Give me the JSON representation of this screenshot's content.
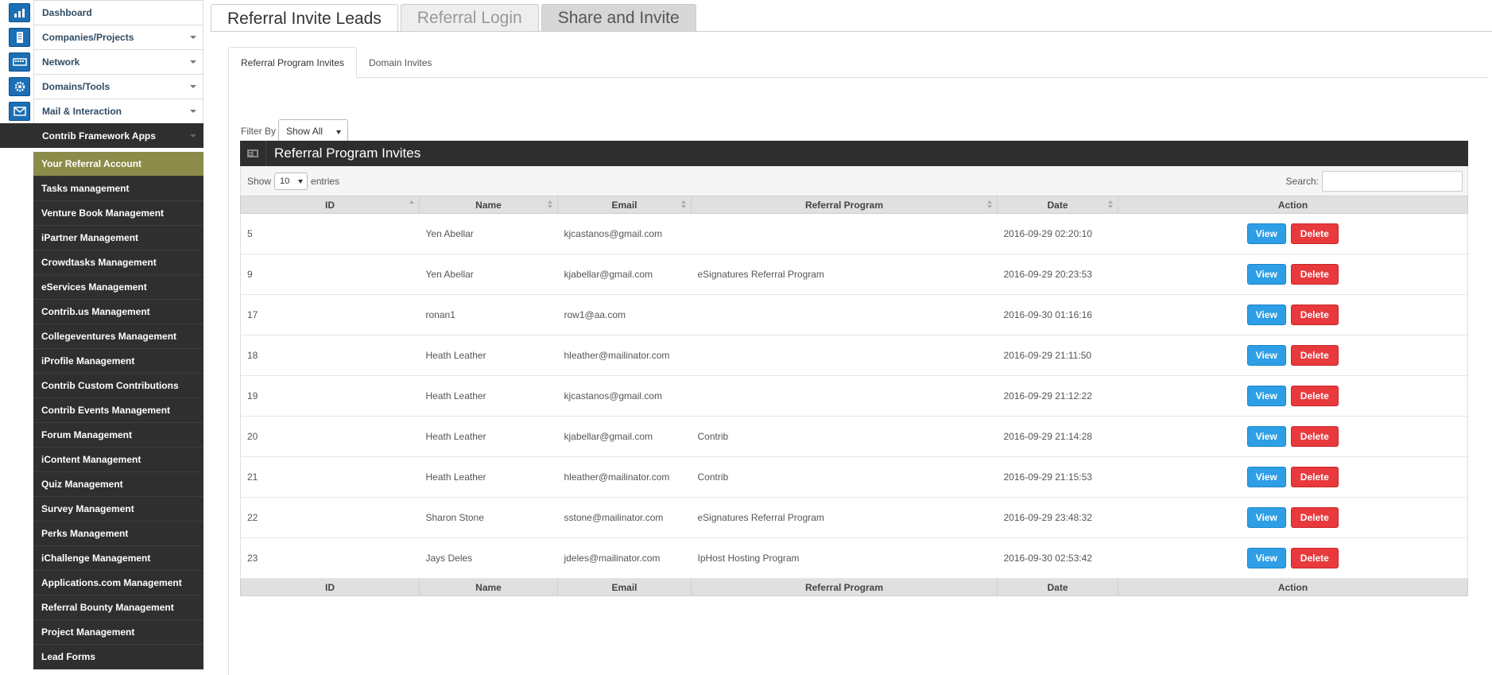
{
  "sidebar": {
    "main_items": [
      {
        "label": "Dashboard",
        "icon": "chart-icon",
        "has_caret": false
      },
      {
        "label": "Companies/Projects",
        "icon": "building-icon",
        "has_caret": true
      },
      {
        "label": "Network",
        "icon": "network-icon",
        "has_caret": true
      },
      {
        "label": "Domains/Tools",
        "icon": "gear-icon",
        "has_caret": true
      },
      {
        "label": "Mail & Interaction",
        "icon": "mail-icon",
        "has_caret": true
      },
      {
        "label": "Contrib Framework Apps",
        "icon": "puzzle-icon",
        "has_caret": true
      }
    ],
    "sub_items": [
      "Your Referral Account",
      "Tasks management",
      "Venture Book Management",
      "iPartner Management",
      "Crowdtasks Management",
      "eServices Management",
      "Contrib.us Management",
      "Collegeventures Management",
      "iProfile Management",
      "Contrib Custom Contributions",
      "Contrib Events Management",
      "Forum Management",
      "iContent Management",
      "Quiz Management",
      "Survey Management",
      "Perks Management",
      "iChallenge Management",
      "Applications.com Management",
      "Referral Bounty Management",
      "Project Management",
      "Lead Forms"
    ],
    "active_sub": "Your Referral Account"
  },
  "top_tabs": [
    "Referral Invite Leads",
    "Referral Login",
    "Share and Invite"
  ],
  "sub_tabs": [
    "Referral Program Invites",
    "Domain Invites"
  ],
  "filter": {
    "label": "Filter By",
    "value": "Show All"
  },
  "box": {
    "title": "Referral Program Invites"
  },
  "length": {
    "show": "Show",
    "value": "10",
    "entries": "entries"
  },
  "search": {
    "label": "Search:"
  },
  "table": {
    "columns": [
      "ID",
      "Name",
      "Email",
      "Referral Program",
      "Date",
      "Action"
    ],
    "rows": [
      {
        "id": "5",
        "name": "Yen Abellar",
        "email": "kjcastanos@gmail.com",
        "program": "",
        "date": "2016-09-29 02:20:10"
      },
      {
        "id": "9",
        "name": "Yen Abellar",
        "email": "kjabellar@gmail.com",
        "program": "eSignatures Referral Program",
        "date": "2016-09-29 20:23:53"
      },
      {
        "id": "17",
        "name": "ronan1",
        "email": "row1@aa.com",
        "program": "",
        "date": "2016-09-30 01:16:16"
      },
      {
        "id": "18",
        "name": "Heath Leather",
        "email": "hleather@mailinator.com",
        "program": "",
        "date": "2016-09-29 21:11:50"
      },
      {
        "id": "19",
        "name": "Heath Leather",
        "email": "kjcastanos@gmail.com",
        "program": "",
        "date": "2016-09-29 21:12:22"
      },
      {
        "id": "20",
        "name": "Heath Leather",
        "email": "kjabellar@gmail.com",
        "program": "Contrib",
        "date": "2016-09-29 21:14:28"
      },
      {
        "id": "21",
        "name": "Heath Leather",
        "email": "hleather@mailinator.com",
        "program": "Contrib",
        "date": "2016-09-29 21:15:53"
      },
      {
        "id": "22",
        "name": "Sharon Stone",
        "email": "sstone@mailinator.com",
        "program": "eSignatures Referral Program",
        "date": "2016-09-29 23:48:32"
      },
      {
        "id": "23",
        "name": "Jays Deles",
        "email": "jdeles@mailinator.com",
        "program": "IpHost Hosting Program",
        "date": "2016-09-30 02:53:42"
      }
    ],
    "view_label": "View",
    "delete_label": "Delete"
  }
}
